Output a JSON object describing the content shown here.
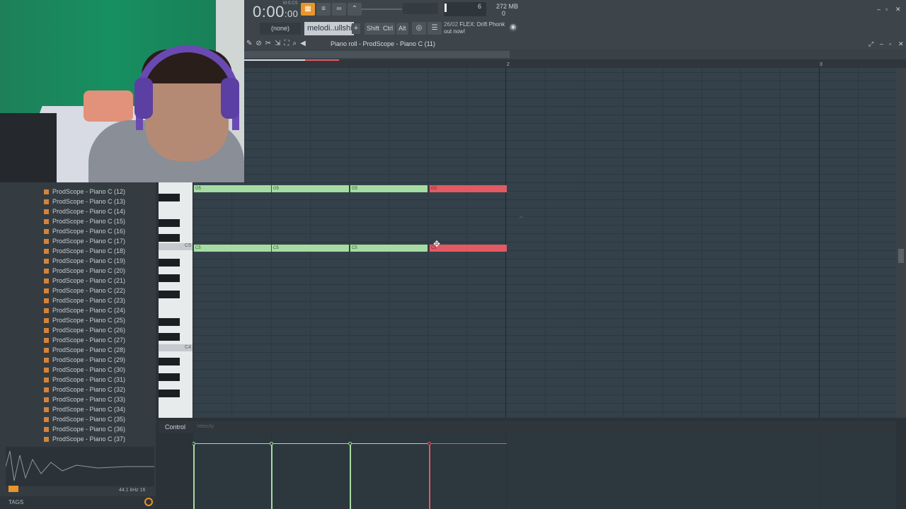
{
  "transport": {
    "time_main": "0:00",
    "time_sub": ":00",
    "time_unit": "M:S:CS",
    "cpu": "6",
    "memory": "272 MB",
    "memory_sub": "0"
  },
  "toolbar": {
    "none_select": "(none)",
    "pattern_name": "melodi..ullshit",
    "plus_label": "+",
    "shift_label": "Shift",
    "ctrl_label": "Ctrl",
    "alt_label": "Alt",
    "news_date": "26/02",
    "news_text_1": "FLEX: Drift Phonk",
    "news_text_2": "out now!"
  },
  "piano_roll": {
    "title": "Piano roll - ProdScope - Piano C (11)",
    "ruler_marks": [
      "2",
      "3"
    ],
    "key_labels": [
      "C5",
      "C4"
    ]
  },
  "notes": {
    "top_row": [
      {
        "label": "G5",
        "color": "green"
      },
      {
        "label": "G5",
        "color": "green"
      },
      {
        "label": "G5",
        "color": "green"
      },
      {
        "label": "G5",
        "color": "red"
      }
    ],
    "bottom_row": [
      {
        "label": "C5",
        "color": "green"
      },
      {
        "label": "C5",
        "color": "green"
      },
      {
        "label": "C5",
        "color": "green"
      },
      {
        "label": "C5",
        "color": "red"
      }
    ]
  },
  "browser": {
    "items": [
      "ProdScope - Piano C (12)",
      "ProdScope - Piano C (13)",
      "ProdScope - Piano C (14)",
      "ProdScope - Piano C (15)",
      "ProdScope - Piano C (16)",
      "ProdScope - Piano C (17)",
      "ProdScope - Piano C (18)",
      "ProdScope - Piano C (19)",
      "ProdScope - Piano C (20)",
      "ProdScope - Piano C (21)",
      "ProdScope - Piano C (22)",
      "ProdScope - Piano C (23)",
      "ProdScope - Piano C (24)",
      "ProdScope - Piano C (25)",
      "ProdScope - Piano C (26)",
      "ProdScope - Piano C (27)",
      "ProdScope - Piano C (28)",
      "ProdScope - Piano C (29)",
      "ProdScope - Piano C (30)",
      "ProdScope - Piano C (31)",
      "ProdScope - Piano C (32)",
      "ProdScope - Piano C (33)",
      "ProdScope - Piano C (34)",
      "ProdScope - Piano C (35)",
      "ProdScope - Piano C (36)",
      "ProdScope - Piano C (37)"
    ],
    "sample_rate": "44.1 kHz 16",
    "tags_label": "TAGS"
  },
  "control": {
    "label": "Control",
    "sub_label": "Velocity"
  },
  "colors": {
    "accent": "#e8952b",
    "note_green": "#a6dca3",
    "note_red": "#e35a63"
  }
}
